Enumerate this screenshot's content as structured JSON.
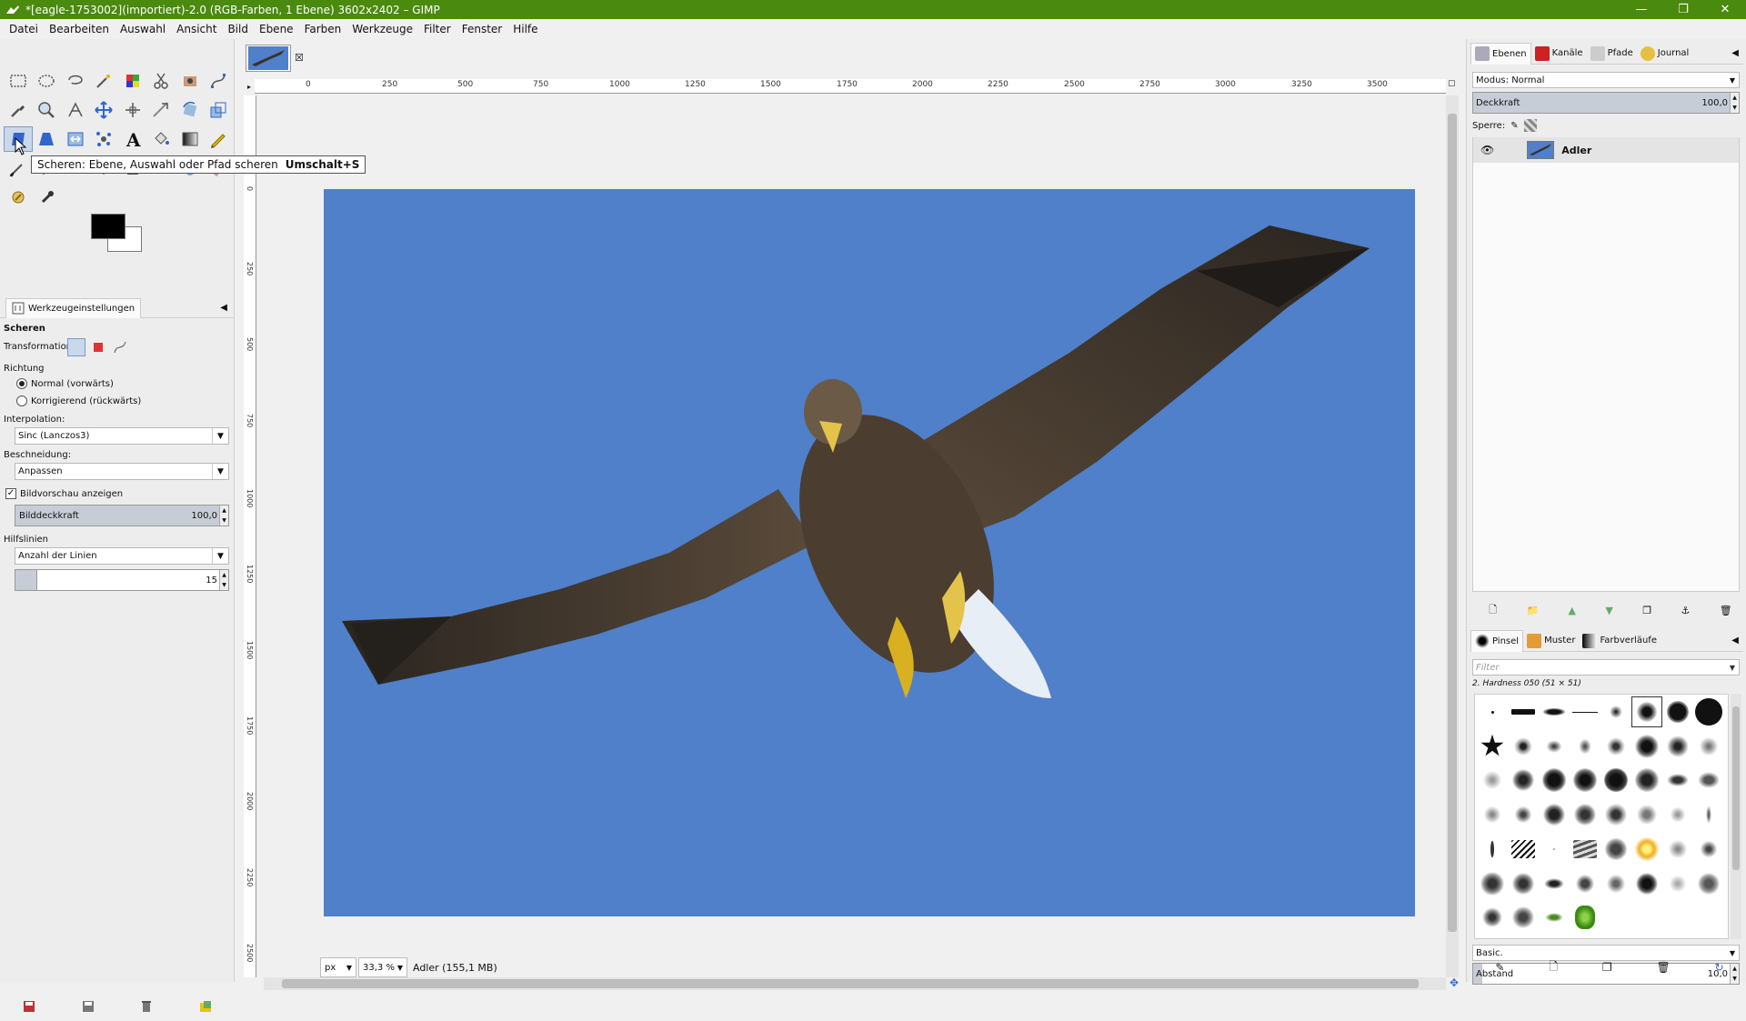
{
  "window": {
    "title": "*[eagle-1753002](importiert)-2.0 (RGB-Farben, 1 Ebene) 3602x2402 – GIMP"
  },
  "menu": [
    "Datei",
    "Bearbeiten",
    "Auswahl",
    "Ansicht",
    "Bild",
    "Ebene",
    "Farben",
    "Werkzeuge",
    "Filter",
    "Fenster",
    "Hilfe"
  ],
  "tooltip": {
    "text": "Scheren: Ebene, Auswahl oder Pfad scheren",
    "accel": "Umschalt+S"
  },
  "tool_options": {
    "tab": "Werkzeugeinstellungen",
    "tool_name": "Scheren",
    "transformation_label": "Transformation:",
    "direction_label": "Richtung",
    "direction_options": [
      "Normal (vorwärts)",
      "Korrigierend (rückwärts)"
    ],
    "interpolation_label": "Interpolation:",
    "interpolation_value": "Sinc (Lanczos3)",
    "clipping_label": "Beschneidung:",
    "clipping_value": "Anpassen",
    "preview_label": "Bildvorschau anzeigen",
    "opacity_label": "Bilddeckkraft",
    "opacity_value": "100,0",
    "guides_label": "Hilfslinien",
    "guides_value": "Anzahl der Linien",
    "lines_value": "15"
  },
  "ruler": {
    "h": [
      "0",
      "250",
      "500",
      "750",
      "1000",
      "1250",
      "1500",
      "1750",
      "2000",
      "2250",
      "2500",
      "2750",
      "3000",
      "3250",
      "3500"
    ],
    "v": [
      "0",
      "250",
      "500",
      "750",
      "1000",
      "1250",
      "1500",
      "1750",
      "2000",
      "2250",
      "2500"
    ]
  },
  "status": {
    "unit": "px",
    "zoom": "33,3 %",
    "info": "Adler (155,1 MB)"
  },
  "layers_dock": {
    "tabs": [
      "Ebenen",
      "Kanäle",
      "Pfade",
      "Journal"
    ],
    "mode_label": "Modus: Normal",
    "opacity_label": "Deckkraft",
    "opacity_value": "100,0",
    "lock_label": "Sperre:",
    "layer_name": "Adler"
  },
  "brush_dock": {
    "tabs": [
      "Pinsel",
      "Muster",
      "Farbverläufe"
    ],
    "filter_placeholder": "Filter",
    "brush_name": "2. Hardness 050 (51 × 51)",
    "preset": "Basic.",
    "spacing_label": "Abstand",
    "spacing_value": "10,0"
  },
  "colors": {
    "titlebar": "#4a8a0f",
    "sky": "#4f80c9"
  }
}
